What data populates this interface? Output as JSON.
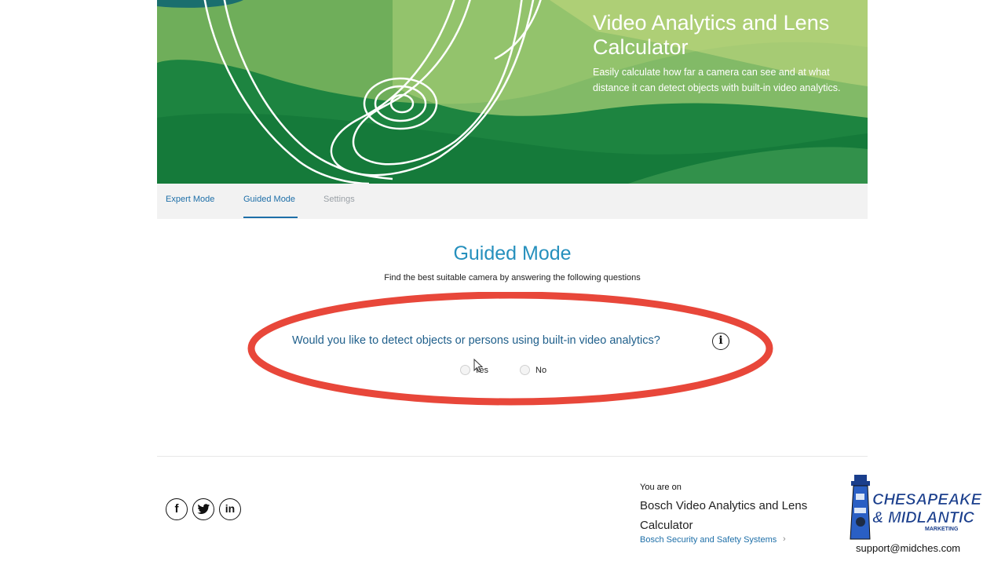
{
  "hero": {
    "title": "Video Analytics and Lens Calculator",
    "subtitle": "Easily calculate how far a camera can see and at what distance it can detect objects with built-in video analytics."
  },
  "tabs": [
    {
      "label": "Expert Mode",
      "state": "normal"
    },
    {
      "label": "Guided Mode",
      "state": "active"
    },
    {
      "label": "Settings",
      "state": "disabled"
    }
  ],
  "guided": {
    "title": "Guided Mode",
    "subtitle": "Find the best suitable camera by answering the following questions",
    "question": "Would you like to detect objects or persons using built-in video analytics?",
    "info_icon": "i",
    "options": [
      {
        "label": "Yes",
        "selected": false
      },
      {
        "label": "No",
        "selected": false
      }
    ],
    "highlight_color": "#e8473a"
  },
  "footer": {
    "social": [
      {
        "icon": "facebook-icon",
        "glyph": "f"
      },
      {
        "icon": "twitter-icon",
        "glyph": "🐦"
      },
      {
        "icon": "linkedin-icon",
        "glyph": "in"
      }
    ],
    "you_are_on": "You are on",
    "site_name": "Bosch Video Analytics and Lens Calculator",
    "link": "Bosch Security and Safety Systems",
    "link_chevron": "›"
  },
  "watermark": {
    "logo_line1": "CHESAPEAKE",
    "logo_line2": "& MIDLANTIC",
    "logo_line3": "MARKETING",
    "support_email": "support@midches.com"
  },
  "colors": {
    "accent": "#2690bd",
    "link": "#1e6fa8",
    "hero_green": "#1f8a44"
  }
}
